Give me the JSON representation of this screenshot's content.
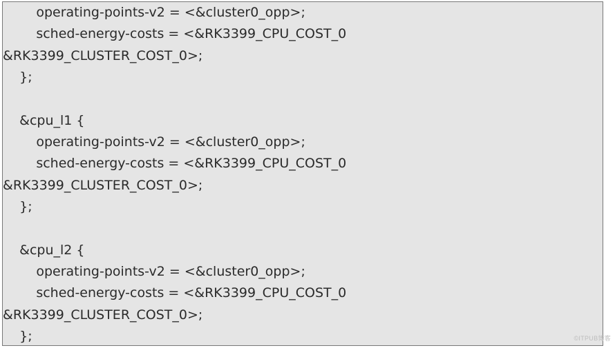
{
  "code": {
    "l01": "        operating-points-v2 = <&cluster0_opp>;",
    "l02": "        sched-energy-costs = <&RK3399_CPU_COST_0",
    "l03": "&RK3399_CLUSTER_COST_0>;",
    "l04": "    };",
    "l05": "",
    "l06": "    &cpu_l1 {",
    "l07": "        operating-points-v2 = <&cluster0_opp>;",
    "l08": "        sched-energy-costs = <&RK3399_CPU_COST_0",
    "l09": "&RK3399_CLUSTER_COST_0>;",
    "l10": "    };",
    "l11": "",
    "l12": "    &cpu_l2 {",
    "l13": "        operating-points-v2 = <&cluster0_opp>;",
    "l14": "        sched-energy-costs = <&RK3399_CPU_COST_0",
    "l15": "&RK3399_CLUSTER_COST_0>;",
    "l16": "    };"
  },
  "watermark": "©ITPUB博客"
}
